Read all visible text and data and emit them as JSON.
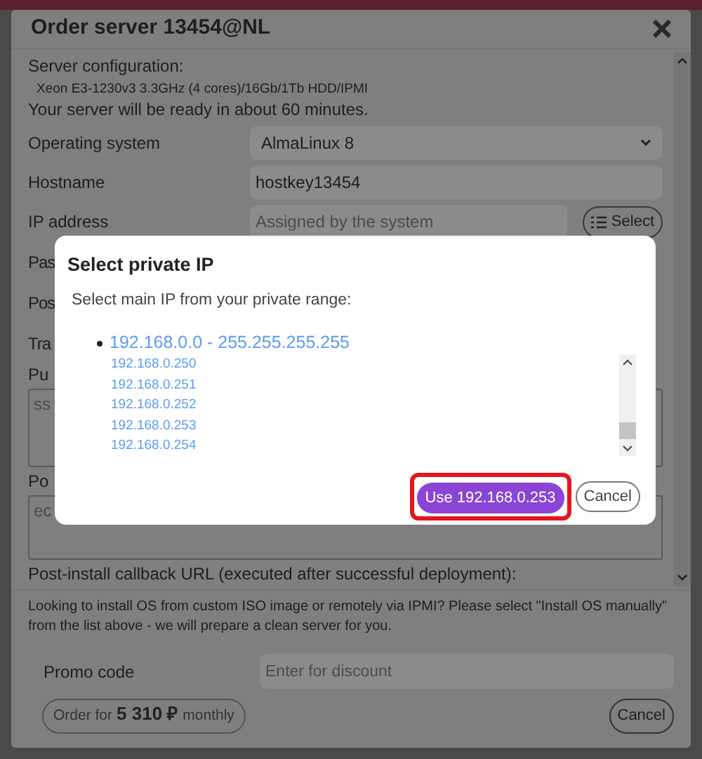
{
  "order_dialog": {
    "title": "Order server 13454@NL",
    "config_label": "Server configuration:",
    "config_detail": "Xeon E3-1230v3 3.3GHz (4 cores)/16Gb/1Tb HDD/IPMI",
    "ready_note": "Your server will be ready in about 60 minutes.",
    "fields": [
      {
        "kind": "select",
        "label": "Operating system",
        "value": "AlmaLinux 8"
      },
      {
        "kind": "text",
        "label": "Hostname",
        "value": "hostkey13454"
      },
      {
        "kind": "picker",
        "label": "IP address",
        "placeholder": "Assigned by the system",
        "button": "Select"
      }
    ],
    "covered_labels": [
      "Pas",
      "Pos",
      "Tra"
    ],
    "text_areas": [
      {
        "label": "Pu",
        "value": "ss"
      },
      {
        "label": "Po",
        "value": "ec"
      }
    ],
    "callback_label": "Post-install callback URL (executed after successful deployment):",
    "notice": "Looking to install OS from custom ISO image or remotely via IPMI? Please select \"Install OS manually\" from the list above - we will prepare a clean server for you.",
    "promo": {
      "label": "Promo code",
      "placeholder": "Enter for discount"
    },
    "order_button": {
      "prefix": "Order for",
      "price": "5 310 ₽",
      "suffix": "monthly"
    },
    "cancel_button": "Cancel"
  },
  "private_ip_dialog": {
    "title": "Select private IP",
    "prompt": "Select main IP from your private range:",
    "range": "192.168.0.0 - 255.255.255.255",
    "addresses": [
      "192.168.0.250",
      "192.168.0.251",
      "192.168.0.252",
      "192.168.0.253",
      "192.168.0.254"
    ],
    "confirm_button": "Use 192.168.0.253",
    "confirm_highlighted": true,
    "cancel_button": "Cancel"
  }
}
